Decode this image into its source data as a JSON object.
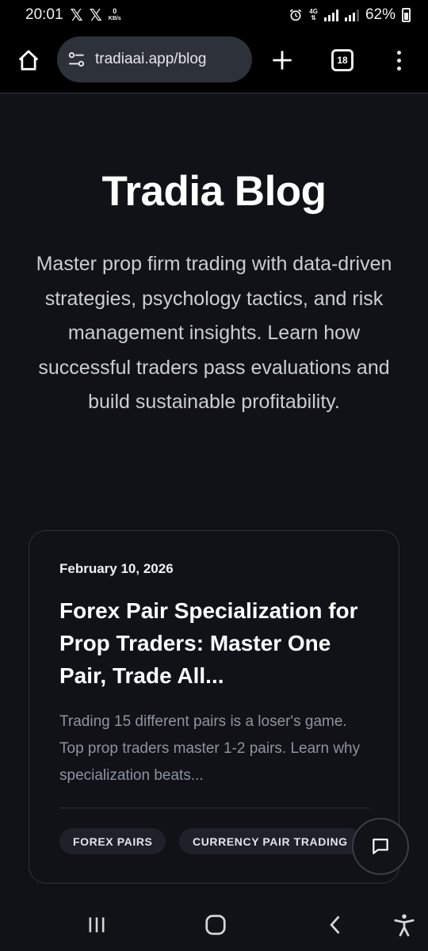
{
  "status_bar": {
    "time": "20:01",
    "x_icon_1": "𝕏",
    "x_icon_2": "𝕏",
    "data_speed_value": "0",
    "data_speed_unit": "KB/s",
    "network_type": "4G",
    "battery": "62%"
  },
  "browser": {
    "url": "tradiaai.app/blog",
    "tab_count": "18"
  },
  "page": {
    "title": "Tradia Blog",
    "description": "Master prop firm trading with data-driven strategies, psychology tactics, and risk management insights. Learn how successful traders pass evaluations and build sustainable profitability."
  },
  "post": {
    "date": "February 10, 2026",
    "title": "Forex Pair Specialization for Prop Traders: Master One Pair, Trade All...",
    "excerpt": "Trading 15 different pairs is a loser's game. Top prop traders master 1-2 pairs. Learn why specialization beats...",
    "tags": [
      "FOREX PAIRS",
      "CURRENCY PAIR TRADING"
    ]
  },
  "icons": {
    "home": "home-icon",
    "site_settings": "tune-icon",
    "new_tab": "plus-icon",
    "menu": "more-vert-icon",
    "chat": "chat-bubble-icon",
    "recents": "recents-icon",
    "nav_home": "nav-home-icon",
    "back": "back-icon",
    "accessibility": "accessibility-icon",
    "alarm": "alarm-icon",
    "signal": "signal-icon",
    "battery": "battery-icon"
  },
  "colors": {
    "page_background": "#101217",
    "card_border": "#2f323a",
    "tag_background": "#1e2128",
    "url_pill": "#2d313a"
  }
}
